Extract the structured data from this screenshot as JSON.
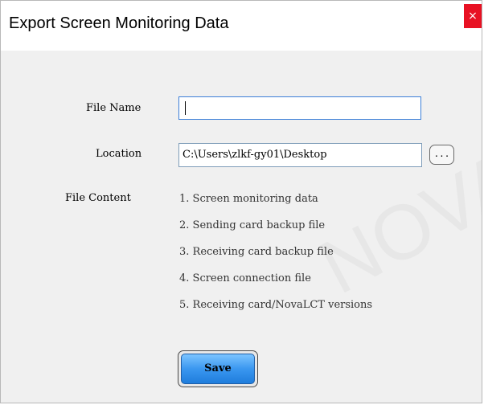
{
  "window": {
    "title": "Export Screen Monitoring Data",
    "close_icon": "close-icon",
    "close_glyph": "×",
    "close_color": "#e81123"
  },
  "form": {
    "file_name_label": "File Name",
    "file_name_value": "",
    "location_label": "Location",
    "location_value": "C:\\Users\\zlkf-gy01\\Desktop",
    "browse_label": "...",
    "file_content_label": "File Content",
    "file_content_items": [
      "1. Screen monitoring data",
      "2. Sending card backup file",
      "3. Receiving card backup file",
      "4. Screen connection file",
      "5. Receiving card/NovaLCT versions"
    ],
    "save_label": "Save",
    "save_color": "#3a97f0"
  },
  "watermark": {
    "text": "NOVASTAR"
  }
}
